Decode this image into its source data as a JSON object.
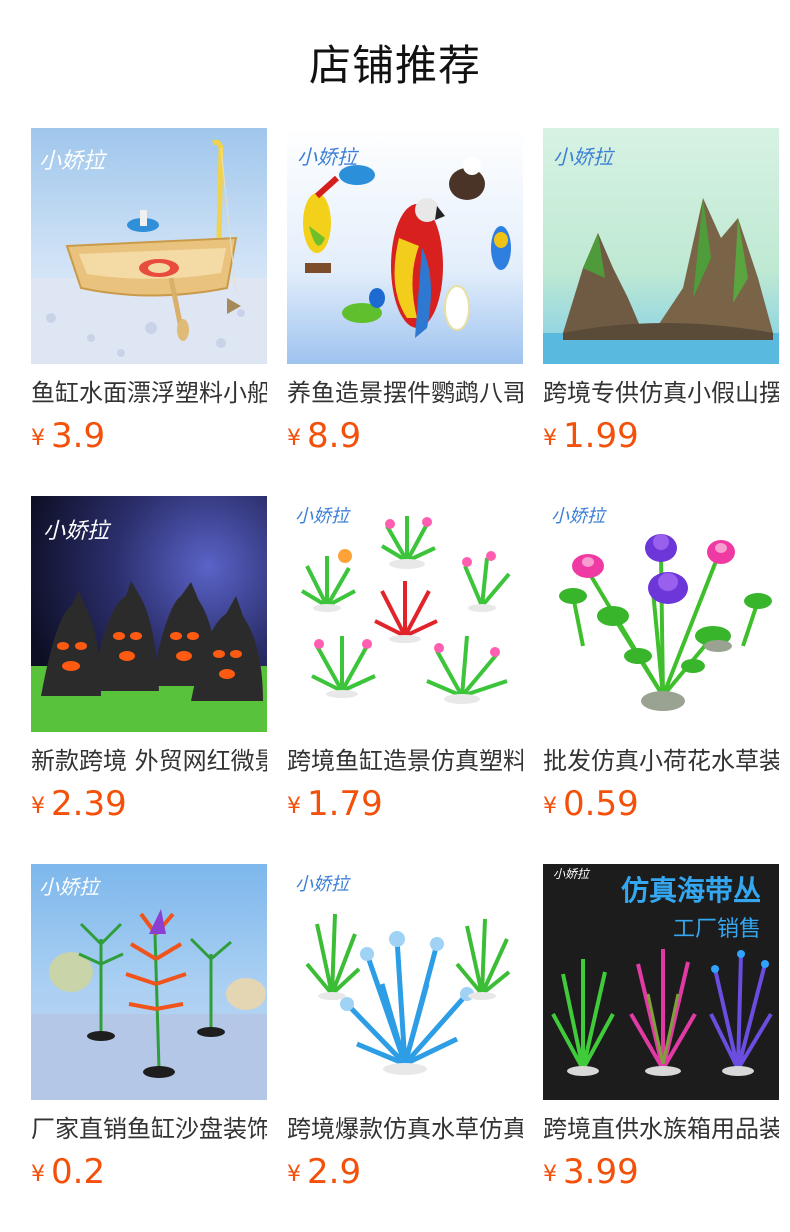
{
  "page": {
    "title": "店铺推荐"
  },
  "colors": {
    "price": "#f3500a",
    "title": "#111111"
  },
  "products": [
    {
      "name": "鱼缸水面漂浮塑料小船",
      "currency": "¥",
      "price": "3.9",
      "image_logo": "小娇拉"
    },
    {
      "name": "养鱼造景摆件鹦鹉八哥",
      "currency": "¥",
      "price": "8.9",
      "image_logo": "小娇拉"
    },
    {
      "name": "跨境专供仿真小假山摆件",
      "currency": "¥",
      "price": "1.99",
      "image_logo": "小娇拉"
    },
    {
      "name": "新款跨境 外贸网红微景观",
      "currency": "¥",
      "price": "2.39",
      "image_logo": "小娇拉"
    },
    {
      "name": "跨境鱼缸造景仿真塑料水草",
      "currency": "¥",
      "price": "1.79",
      "image_logo": "小娇拉"
    },
    {
      "name": "批发仿真小荷花水草装饰",
      "currency": "¥",
      "price": "0.59",
      "image_logo": "小娇拉"
    },
    {
      "name": "厂家直销鱼缸沙盘装饰",
      "currency": "¥",
      "price": "0.2",
      "image_logo": "小娇拉"
    },
    {
      "name": "跨境爆款仿真水草仿真",
      "currency": "¥",
      "price": "2.9",
      "image_logo": "小娇拉"
    },
    {
      "name": "跨境直供水族箱用品装饰",
      "currency": "¥",
      "price": "3.99",
      "image_logo": "小娇拉",
      "image_banner_title": "仿真海带丛",
      "image_banner_sub": "工厂销售"
    }
  ]
}
